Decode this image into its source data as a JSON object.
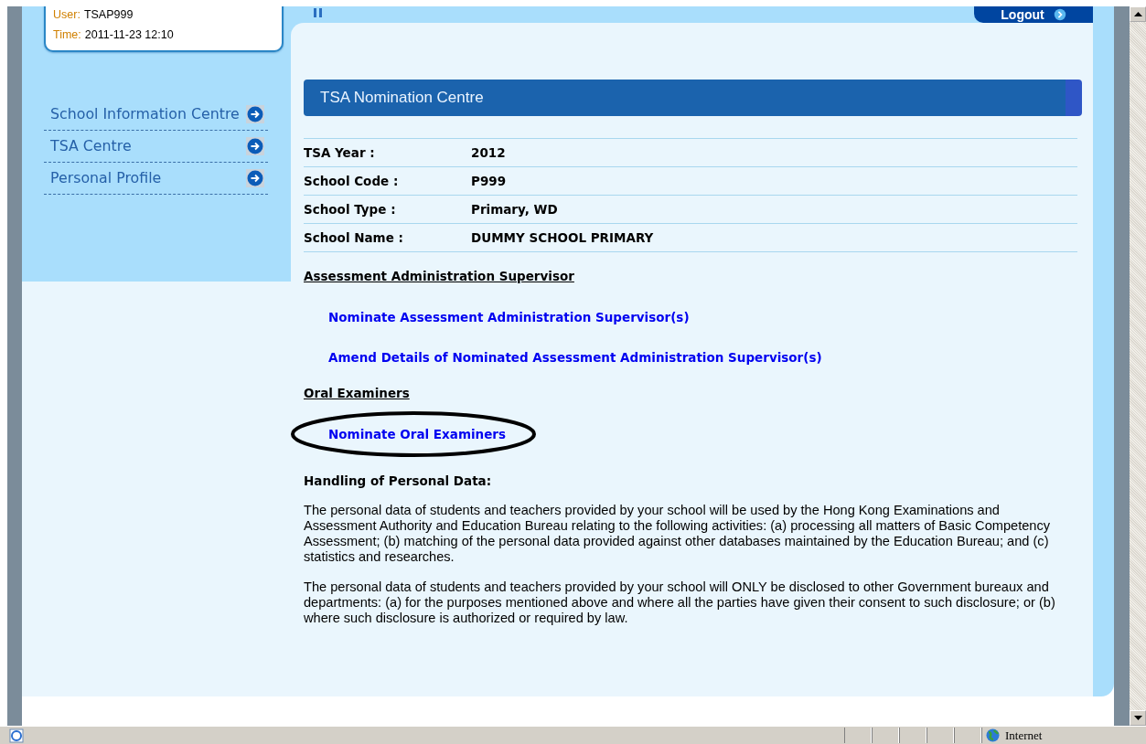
{
  "session": {
    "user_label": "User:",
    "user": "TSAP999",
    "time_label": "Time:",
    "time": "2011-11-23 12:10"
  },
  "logout": "Logout",
  "sidebar": {
    "items": [
      {
        "label": "School Information Centre"
      },
      {
        "label": "TSA Centre"
      },
      {
        "label": "Personal Profile"
      }
    ]
  },
  "page_title": "TSA Nomination Centre",
  "info": [
    {
      "label": "TSA Year :",
      "value": "2012"
    },
    {
      "label": "School Code :",
      "value": "P999"
    },
    {
      "label": "School Type :",
      "value": "Primary, WD"
    },
    {
      "label": "School Name :",
      "value": "DUMMY SCHOOL PRIMARY"
    }
  ],
  "sections": [
    {
      "heading": "Assessment Administration Supervisor",
      "links": [
        {
          "text": "Nominate Assessment Administration Supervisor(s)",
          "circled": false
        },
        {
          "text": "Amend Details of Nominated Assessment Administration Supervisor(s)",
          "circled": false
        }
      ]
    },
    {
      "heading": "Oral Examiners",
      "links": [
        {
          "text": "Nominate Oral Examiners",
          "circled": true
        }
      ]
    }
  ],
  "personal_data": {
    "heading": "Handling of Personal Data:",
    "paragraphs": [
      "The personal data of students and teachers provided by your school will be used by the Hong Kong Examinations and Assessment Authority and Education Bureau relating to the following activities: (a) processing all matters of Basic Competency Assessment; (b) matching of the personal data provided against other databases maintained by the Education Bureau; and (c) statistics and researches.",
      "The personal data of students and teachers provided by your school will ONLY be disclosed to other Government bureaux and departments: (a) for the purposes mentioned above and where all the parties have given their consent to such disclosure; or (b) where such disclosure is authorized or required by law."
    ]
  },
  "status_bar": {
    "zone": "Internet"
  }
}
